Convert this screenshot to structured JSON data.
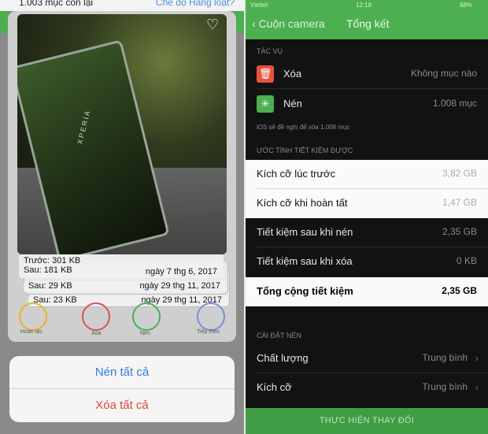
{
  "left": {
    "remaining_count": "1.003 mục còn lại",
    "mode_link": "Chế độ Hàng loạt?",
    "photo_brand": "XPERIA",
    "cards": [
      {
        "before": "Trước: 301 KB",
        "after": "Sau: 181 KB",
        "date": "ngày 7 thg 6, 2017"
      },
      {
        "after": "Sau: 29 KB",
        "date": "ngày 29 thg 11, 2017"
      },
      {
        "after": "Sau: 23 KB",
        "date": "ngày 29 thg 11, 2017"
      }
    ],
    "bottom_actions": [
      "Hoàn tác",
      "Xóa",
      "Nén",
      "Tiếp theo"
    ],
    "action_sheet": {
      "compress_all": "Nén tất cả",
      "delete_all": "Xóa tất cả"
    }
  },
  "right": {
    "status": {
      "carrier": "Viettel",
      "time": "12:18",
      "battery": "68%"
    },
    "nav": {
      "back": "Cuộn camera",
      "title": "Tổng kết"
    },
    "tasks_header": "TÁC VỤ",
    "tasks": [
      {
        "label": "Xóa",
        "value": "Không mục nào",
        "icon": "trash-icon",
        "color": "#e5533b"
      },
      {
        "label": "Nén",
        "value": "1.008 mục",
        "icon": "compress-icon",
        "color": "#4caf50"
      }
    ],
    "tasks_note": "iOS sẽ đề nghị để xóa 1.008 mục",
    "savings_header": "ƯỚC TÍNH TIẾT KIỆM ĐƯỢC",
    "savings": [
      {
        "label": "Kích cỡ lúc trước",
        "value": "3,82 GB",
        "highlight": true
      },
      {
        "label": "Kích cỡ khi hoàn tất",
        "value": "1,47 GB",
        "highlight": true
      },
      {
        "label": "Tiết kiệm sau khi nén",
        "value": "2,35 GB",
        "highlight": false
      },
      {
        "label": "Tiết kiệm sau khi xóa",
        "value": "0 KB",
        "highlight": false
      }
    ],
    "total": {
      "label": "Tổng cộng tiết kiệm",
      "value": "2,35 GB"
    },
    "compress_settings_header": "CÀI ĐẶT NÉN",
    "compress_settings": [
      {
        "label": "Chất lượng",
        "value": "Trung bình"
      },
      {
        "label": "Kích cỡ",
        "value": "Trung bình"
      }
    ],
    "apply_button": "THỰC HIỆN THAY ĐỔI"
  }
}
